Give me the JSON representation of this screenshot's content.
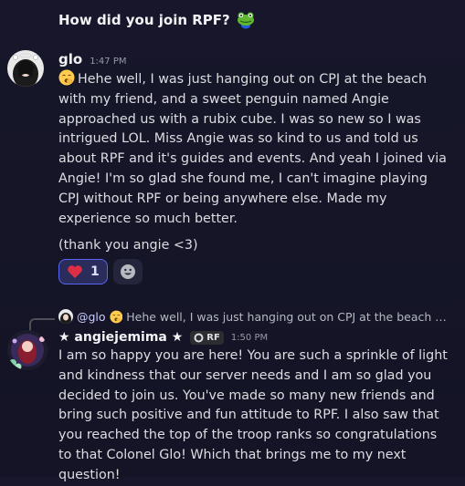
{
  "thread": {
    "title": "How did you join RPF?",
    "title_emoji": "frog-emoji"
  },
  "message1": {
    "author": "glo",
    "time": "1:47 PM",
    "emoji": "yawning-face-emoji",
    "text": "Hehe well, I was just hanging out on CPJ at the beach with my friend, and a sweet penguin named Angie approached us with a rubix cube. I was so new so I was intrigued LOL. Miss Angie was so kind to us and told us about RPF and it's guides and events. And yeah I joined via Angie! I'm so glad she found me, I can't imagine playing CPJ without RPF or being anywhere else. Made my experience so much better.",
    "footer": "(thank you angie <3)",
    "reaction": {
      "emoji": "heart",
      "count": "1",
      "color": "#dd2e44"
    }
  },
  "message2": {
    "reply": {
      "mention": "@glo",
      "emoji": "yawning-face-emoji",
      "snippet": "Hehe well, I was just hanging out on CPJ at the beach wi..."
    },
    "author": "★ angiejemima ★",
    "tag": "RF",
    "time": "1:50 PM",
    "text": "I am so happy you are here! You are such a sprinkle of light and kindness that our server needs and I am so glad you decided to join us. You've made so many new friends and bring such positive and fun attitude to RPF. I also saw that you reached the top of the troop ranks so congratulations to that Colonel Glo! Which that brings me to my next question!"
  },
  "colors": {
    "background": "#17162a",
    "accent": "#5865f2",
    "text": "#dbdee1"
  }
}
